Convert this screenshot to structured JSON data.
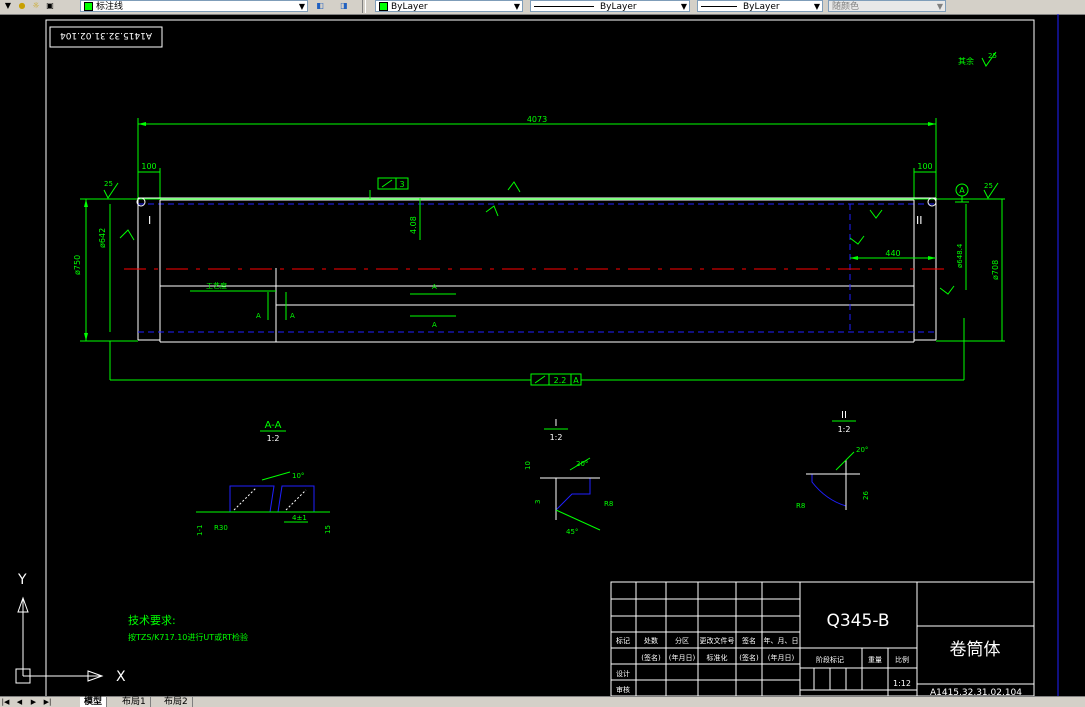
{
  "toolbar": {
    "layer_name": "标注线",
    "color_control": "ByLayer",
    "linetype_control": "ByLayer",
    "lineweight_control": "ByLayer",
    "plotstyle_control": "随颜色"
  },
  "drawing": {
    "rotated_code": "A1415.32.31.02.104",
    "roughness_other_label": "其余",
    "roughness_value": "25",
    "dim_overall": "4073",
    "dim_left_end": "100",
    "dim_right_end": "100",
    "dim_440": "440",
    "dim_phi750": "ø750",
    "dim_phi642": "ø642",
    "dim_phi708": "ø708",
    "dim_phi648": "ø648.4",
    "dim_408": "4.08",
    "dim_3": "3",
    "dim_0.5": "0.5",
    "flatness_value": "3",
    "runout_value": "2.2",
    "datum_a": "A",
    "detail_left_label": "I",
    "detail_right_label": "II",
    "arrow_a": "A",
    "zone_label": "工艺度",
    "section_aa_title": "A-A",
    "section_aa_scale": "1:2",
    "section_i_title": "I",
    "section_i_scale": "1:2",
    "section_ii_title": "II",
    "section_ii_scale": "1:2",
    "aa_angle": "10°",
    "aa_r30": "R30",
    "aa_gap": "4±1",
    "aa_left": "1-1",
    "aa_right": "15",
    "i_angle": "20°",
    "i_10": "10",
    "i_3": "3",
    "i_r8": "R8",
    "i_45": "45°",
    "ii_angle": "20°",
    "ii_r8": "R8",
    "ii_26": "26"
  },
  "tech_req": {
    "title": "技术要求:",
    "line1": "按TZS/K717.10进行UT或RT检验"
  },
  "title_block": {
    "material": "Q345-B",
    "part_name": "卷筒体",
    "drawing_no": "A1415.32.31.02.104",
    "scale_value": "1:12",
    "headers": [
      "标记",
      "处数",
      "分区",
      "更改文件号",
      "签名",
      "年、月、日"
    ],
    "sub_headers": [
      "(签名)",
      "(年月日)",
      "标准化",
      "(签名)",
      "(年月日)"
    ],
    "design_label": "设计",
    "review_label": "审核",
    "stage_label": "阶段标记",
    "weight_label": "重量",
    "scale_label": "比例"
  },
  "ucs": {
    "y": "Y",
    "x": "X"
  },
  "tabs": [
    "模型",
    "布局1",
    "布局2"
  ]
}
